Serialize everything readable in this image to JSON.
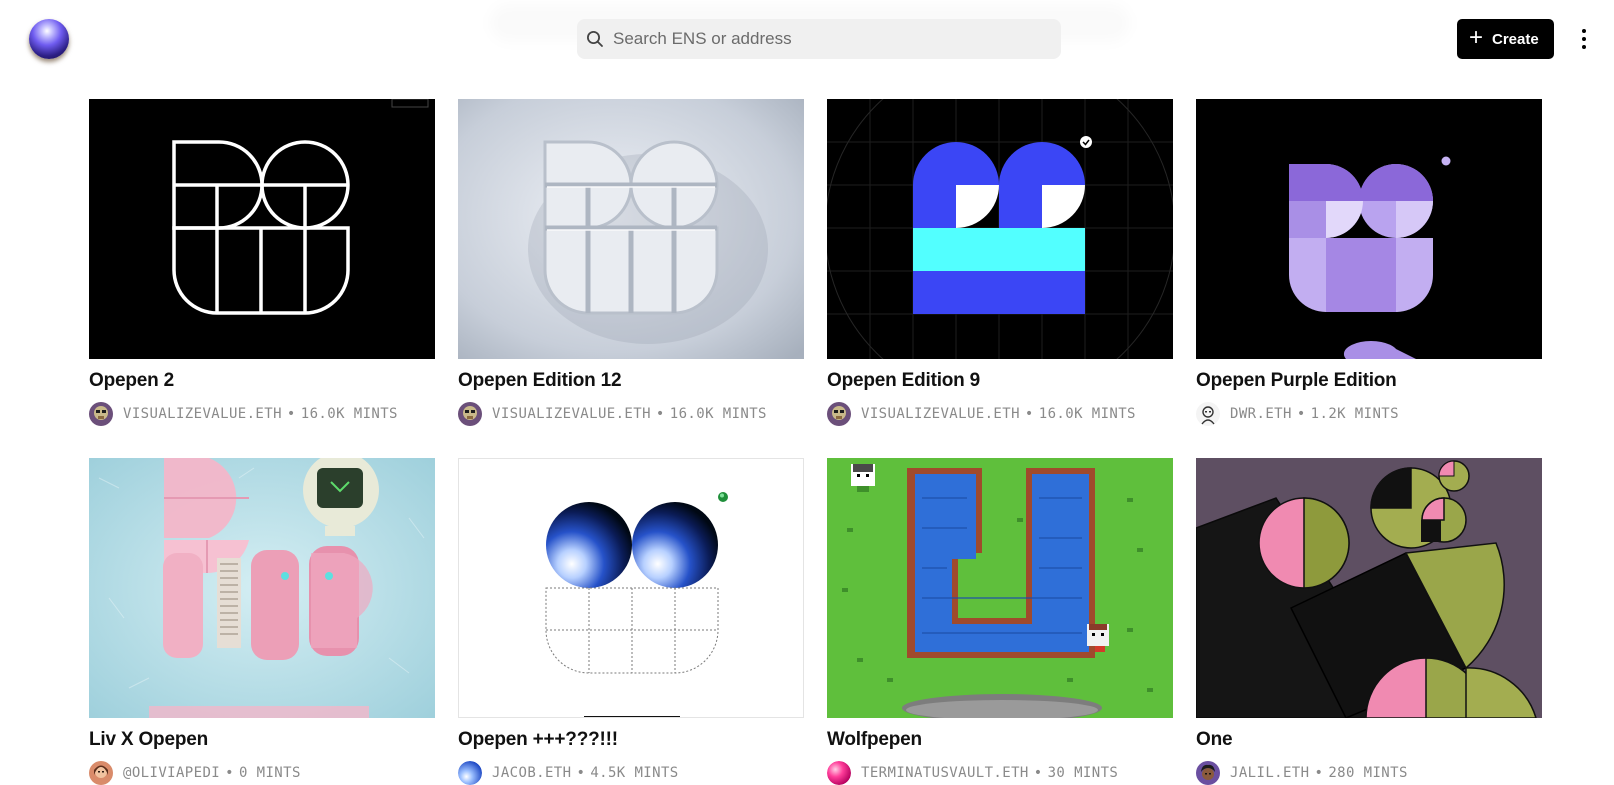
{
  "header": {
    "search_placeholder": "Search ENS or address",
    "create_label": "Create"
  },
  "colors": {
    "accent_black": "#000000",
    "meta_gray": "#8a8a8a",
    "search_bg": "#f0f0f0"
  },
  "cards": [
    {
      "title": "Opepen 2",
      "creator": "VISUALIZEVALUE.ETH",
      "mints": "16.0K MINTS",
      "avatar": "ape-avatar"
    },
    {
      "title": "Opepen Edition 12",
      "creator": "VISUALIZEVALUE.ETH",
      "mints": "16.0K MINTS",
      "avatar": "ape-avatar"
    },
    {
      "title": "Opepen Edition 9",
      "creator": "VISUALIZEVALUE.ETH",
      "mints": "16.0K MINTS",
      "avatar": "ape-avatar"
    },
    {
      "title": "Opepen Purple Edition",
      "creator": "DWR.ETH",
      "mints": "1.2K MINTS",
      "avatar": "sketch-avatar"
    },
    {
      "title": "Liv X Opepen",
      "creator": "@OLIVIAPEDI",
      "mints": "0 MINTS",
      "avatar": "photo-avatar"
    },
    {
      "title": "Opepen +++???!!!",
      "creator": "JACOB.ETH",
      "mints": "4.5K MINTS",
      "avatar": "orb-avatar"
    },
    {
      "title": "Wolfpepen",
      "creator": "TERMINATUSVAULT.ETH",
      "mints": "30 MINTS",
      "avatar": "pink-orb-avatar"
    },
    {
      "title": "One",
      "creator": "JALIL.ETH",
      "mints": "280 MINTS",
      "avatar": "portrait-avatar"
    }
  ]
}
